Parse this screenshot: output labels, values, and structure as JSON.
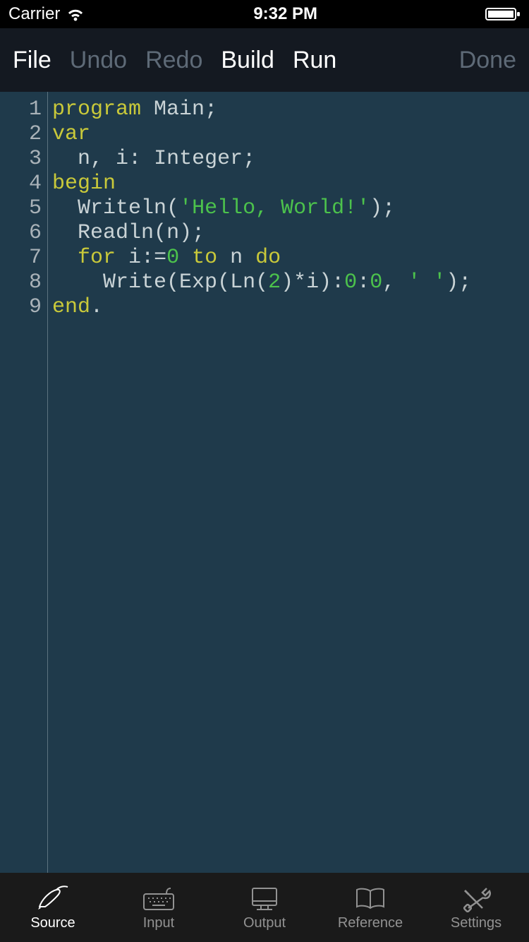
{
  "status": {
    "carrier": "Carrier",
    "time": "9:32 PM"
  },
  "toolbar": {
    "file": "File",
    "undo": "Undo",
    "redo": "Redo",
    "build": "Build",
    "run": "Run",
    "done": "Done"
  },
  "editor": {
    "lines": [
      {
        "n": "1",
        "tokens": [
          {
            "t": "program",
            "c": "kw"
          },
          {
            "t": " ",
            "c": "sp"
          },
          {
            "t": "Main",
            "c": "id"
          },
          {
            "t": ";",
            "c": "punc"
          }
        ]
      },
      {
        "n": "2",
        "tokens": [
          {
            "t": "var",
            "c": "kw"
          }
        ]
      },
      {
        "n": "3",
        "tokens": [
          {
            "t": "  ",
            "c": "sp"
          },
          {
            "t": "n",
            "c": "id"
          },
          {
            "t": ", ",
            "c": "punc"
          },
          {
            "t": "i",
            "c": "id"
          },
          {
            "t": ": ",
            "c": "punc"
          },
          {
            "t": "Integer",
            "c": "id"
          },
          {
            "t": ";",
            "c": "punc"
          }
        ]
      },
      {
        "n": "4",
        "tokens": [
          {
            "t": "begin",
            "c": "kw"
          }
        ]
      },
      {
        "n": "5",
        "tokens": [
          {
            "t": "  ",
            "c": "sp"
          },
          {
            "t": "Writeln",
            "c": "id"
          },
          {
            "t": "(",
            "c": "punc"
          },
          {
            "t": "'Hello, World!'",
            "c": "str"
          },
          {
            "t": ");",
            "c": "punc"
          }
        ]
      },
      {
        "n": "6",
        "tokens": [
          {
            "t": "  ",
            "c": "sp"
          },
          {
            "t": "Readln",
            "c": "id"
          },
          {
            "t": "(",
            "c": "punc"
          },
          {
            "t": "n",
            "c": "id"
          },
          {
            "t": ");",
            "c": "punc"
          }
        ]
      },
      {
        "n": "7",
        "tokens": [
          {
            "t": "  ",
            "c": "sp"
          },
          {
            "t": "for",
            "c": "kw"
          },
          {
            "t": " ",
            "c": "sp"
          },
          {
            "t": "i",
            "c": "id"
          },
          {
            "t": ":=",
            "c": "punc"
          },
          {
            "t": "0",
            "c": "num"
          },
          {
            "t": " ",
            "c": "sp"
          },
          {
            "t": "to",
            "c": "kw"
          },
          {
            "t": " ",
            "c": "sp"
          },
          {
            "t": "n",
            "c": "id"
          },
          {
            "t": " ",
            "c": "sp"
          },
          {
            "t": "do",
            "c": "kw"
          }
        ]
      },
      {
        "n": "8",
        "tokens": [
          {
            "t": "    ",
            "c": "sp"
          },
          {
            "t": "Write",
            "c": "id"
          },
          {
            "t": "(",
            "c": "punc"
          },
          {
            "t": "Exp",
            "c": "id"
          },
          {
            "t": "(",
            "c": "punc"
          },
          {
            "t": "Ln",
            "c": "id"
          },
          {
            "t": "(",
            "c": "punc"
          },
          {
            "t": "2",
            "c": "num"
          },
          {
            "t": ")*",
            "c": "punc"
          },
          {
            "t": "i",
            "c": "id"
          },
          {
            "t": "):",
            "c": "punc"
          },
          {
            "t": "0",
            "c": "num"
          },
          {
            "t": ":",
            "c": "punc"
          },
          {
            "t": "0",
            "c": "num"
          },
          {
            "t": ", ",
            "c": "punc"
          },
          {
            "t": "' '",
            "c": "str"
          },
          {
            "t": ");",
            "c": "punc"
          }
        ]
      },
      {
        "n": "9",
        "tokens": [
          {
            "t": "end",
            "c": "kw"
          },
          {
            "t": ".",
            "c": "punc"
          }
        ]
      }
    ]
  },
  "tabs": {
    "source": "Source",
    "input": "Input",
    "output": "Output",
    "reference": "Reference",
    "settings": "Settings"
  }
}
